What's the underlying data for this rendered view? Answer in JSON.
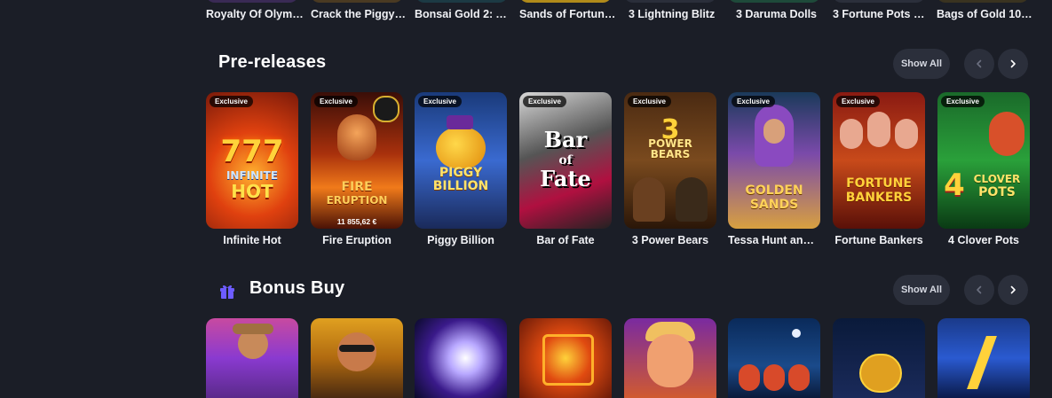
{
  "top_row": {
    "titles": [
      "Royalty Of Olym…",
      "Crack the Piggy …",
      "Bonsai Gold 2: A…",
      "Sands of Fortun…",
      "3 Lightning Blitz",
      "3 Daruma Dolls",
      "3 Fortune Pots H…",
      "Bags of Gold 10…"
    ]
  },
  "pre_releases": {
    "title": "Pre-releases",
    "show_all": "Show All",
    "games": [
      {
        "title": "Infinite Hot",
        "badge": "Exclusive",
        "logo": "777 INFINITE HOT"
      },
      {
        "title": "Fire Eruption",
        "badge": "Exclusive",
        "logo": "FIRE ERUPTION",
        "jackpot": "11 855,62 €"
      },
      {
        "title": "Piggy Billion",
        "badge": "Exclusive",
        "logo": "PIGGY BILLION"
      },
      {
        "title": "Bar of Fate",
        "badge": "Exclusive",
        "logo": "Bar of Fate"
      },
      {
        "title": "3 Power Bears",
        "badge": "Exclusive",
        "logo": "3 POWER BEARS"
      },
      {
        "title": "Tessa Hunt and …",
        "badge": "Exclusive",
        "logo": "GOLDEN SANDS"
      },
      {
        "title": "Fortune Bankers",
        "badge": "Exclusive",
        "logo": "FORTUNE BANKERS"
      },
      {
        "title": "4 Clover Pots",
        "badge": "Exclusive",
        "logo": "4 CLOVER POTS"
      }
    ]
  },
  "bonus_buy": {
    "title": "Bonus Buy",
    "show_all": "Show All"
  },
  "colors": {
    "background": "#1b1e27",
    "button_bg": "#2b2f3b",
    "gift_icon": "#6d5cff"
  }
}
